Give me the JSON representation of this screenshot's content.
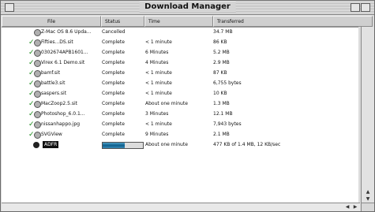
{
  "window": {
    "title": "Download Manager"
  },
  "columns": {
    "file": "File",
    "status": "Status",
    "time": "Time",
    "transferred": "Transferred"
  },
  "rows": [
    {
      "file": "Z-Mac OS 8.6 Upda...",
      "status": "Cancelled",
      "time": "",
      "transferred": "34.7 MB",
      "checked": false
    },
    {
      "file": "Fifties...DS.sit",
      "status": "Complete",
      "time": "< 1 minute",
      "transferred": "86 KB",
      "checked": true
    },
    {
      "file": "0302674APB1601...",
      "status": "Complete",
      "time": "6 Minutes",
      "transferred": "5.2 MB",
      "checked": true
    },
    {
      "file": "Virex 6.1 Demo.sit",
      "status": "Complete",
      "time": "4 Minutes",
      "transferred": "2.9 MB",
      "checked": true
    },
    {
      "file": "bamf.sit",
      "status": "Complete",
      "time": "< 1 minute",
      "transferred": "87 KB",
      "checked": true
    },
    {
      "file": "battle3.sit",
      "status": "Complete",
      "time": "< 1 minute",
      "transferred": "6,755 bytes",
      "checked": true
    },
    {
      "file": "saspers.sit",
      "status": "Complete",
      "time": "< 1 minute",
      "transferred": "10 KB",
      "checked": true
    },
    {
      "file": "MacZoop2.5.sit",
      "status": "Complete",
      "time": "About one minute",
      "transferred": "1.3 MB",
      "checked": true
    },
    {
      "file": "Photoshop_6.0.1...",
      "status": "Complete",
      "time": "3 Minutes",
      "transferred": "12.1 MB",
      "checked": true
    },
    {
      "file": "nissanhappo.jpg",
      "status": "Complete",
      "time": "< 1 minute",
      "transferred": "7,943 bytes",
      "checked": true
    },
    {
      "file": "SVGView",
      "status": "Complete",
      "time": "9 Minutes",
      "transferred": "2.1 MB",
      "checked": true
    }
  ],
  "active": {
    "file": "ADFR",
    "progress": 0.55,
    "time": "About one minute",
    "transferred": "477 KB of 1.4 MB, 12 KB/sec"
  },
  "scroll": {
    "up": "▲",
    "down": "▼",
    "left": "◀",
    "right": "▶"
  }
}
